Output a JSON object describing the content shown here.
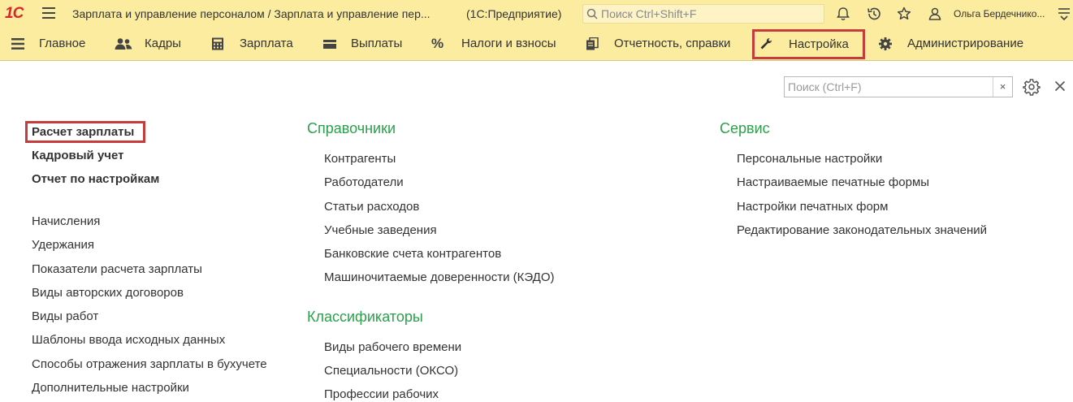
{
  "titlebar": {
    "logo": "1С",
    "title": "Зарплата и управление персоналом / Зарплата и управление пер...",
    "mode": "(1С:Предприятие)",
    "search_placeholder": "Поиск Ctrl+Shift+F",
    "user": "Ольга Бердечнико..."
  },
  "sections": [
    {
      "label": "Главное",
      "icon": "menu-list-icon"
    },
    {
      "label": "Кадры",
      "icon": "people-icon"
    },
    {
      "label": "Зарплата",
      "icon": "calculator-icon"
    },
    {
      "label": "Выплаты",
      "icon": "wallet-icon"
    },
    {
      "label": "Налоги и взносы",
      "icon": "percent-icon"
    },
    {
      "label": "Отчетность, справки",
      "icon": "reports-icon"
    },
    {
      "label": "Настройка",
      "icon": "wrench-icon"
    },
    {
      "label": "Администрирование",
      "icon": "gear-icon"
    }
  ],
  "active_section": "Настройка",
  "content_search": {
    "placeholder": "Поиск (Ctrl+F)",
    "clear": "×"
  },
  "left_column": {
    "bold_links": [
      "Расчет зарплаты",
      "Кадровый учет",
      "Отчет по настройкам"
    ],
    "links": [
      "Начисления",
      "Удержания",
      "Показатели расчета зарплаты",
      "Виды авторских договоров",
      "Виды работ",
      "Шаблоны ввода исходных данных",
      "Способы отражения зарплаты в бухучете",
      "Дополнительные настройки"
    ]
  },
  "middle_column": {
    "groups": [
      {
        "title": "Справочники",
        "items": [
          "Контрагенты",
          "Работодатели",
          "Статьи расходов",
          "Учебные заведения",
          "Банковские счета контрагентов",
          "Машиночитаемые доверенности (КЭДО)"
        ]
      },
      {
        "title": "Классификаторы",
        "items": [
          "Виды рабочего времени",
          "Специальности (ОКСО)",
          "Профессии рабочих"
        ]
      }
    ]
  },
  "right_column": {
    "title": "Сервис",
    "items": [
      "Персональные настройки",
      "Настраиваемые печатные формы",
      "Настройки печатных форм",
      "Редактирование законодательных значений"
    ]
  },
  "colors": {
    "panel_bg": "#fbeca0",
    "group_title": "#2aa14a",
    "highlight": "#c43c3c",
    "logo": "#d8262b"
  }
}
